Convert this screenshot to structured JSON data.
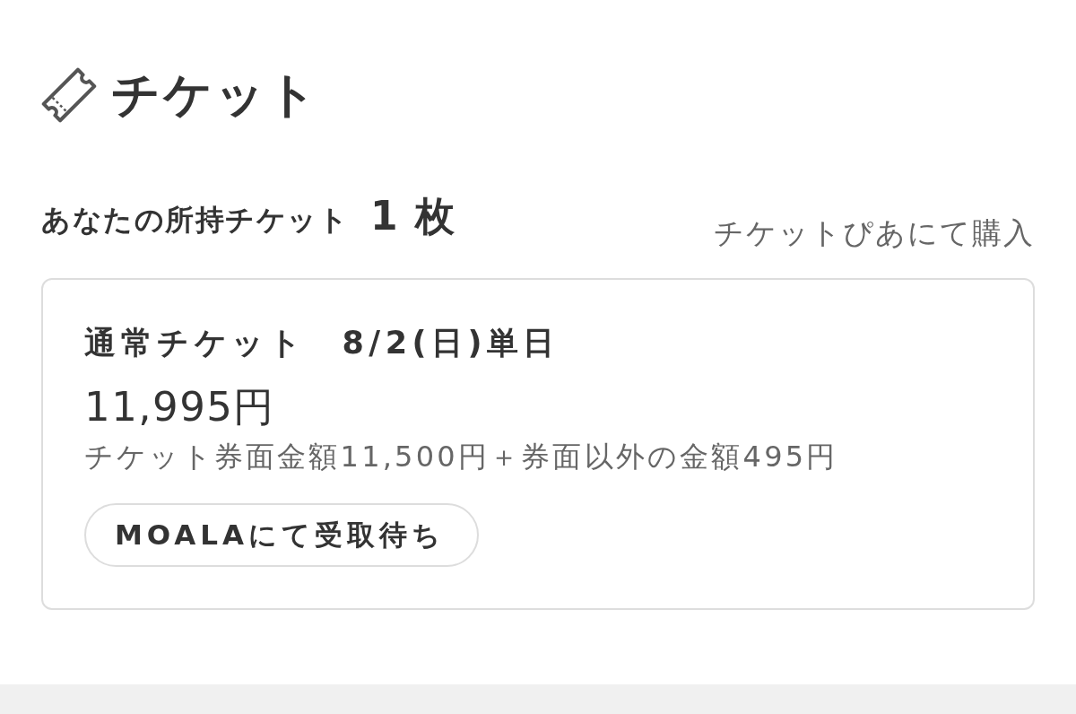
{
  "header": {
    "title": "チケット"
  },
  "summary": {
    "label": "あなたの所持チケット",
    "count": "1 枚",
    "purchase_source": "チケットぴあにて購入"
  },
  "tickets": [
    {
      "name": "通常チケット　8/2(日)単日",
      "price": "11,995円",
      "breakdown": "チケット券面金額11,500円＋券面以外の金額495円",
      "status": "MOALAにて受取待ち"
    }
  ]
}
